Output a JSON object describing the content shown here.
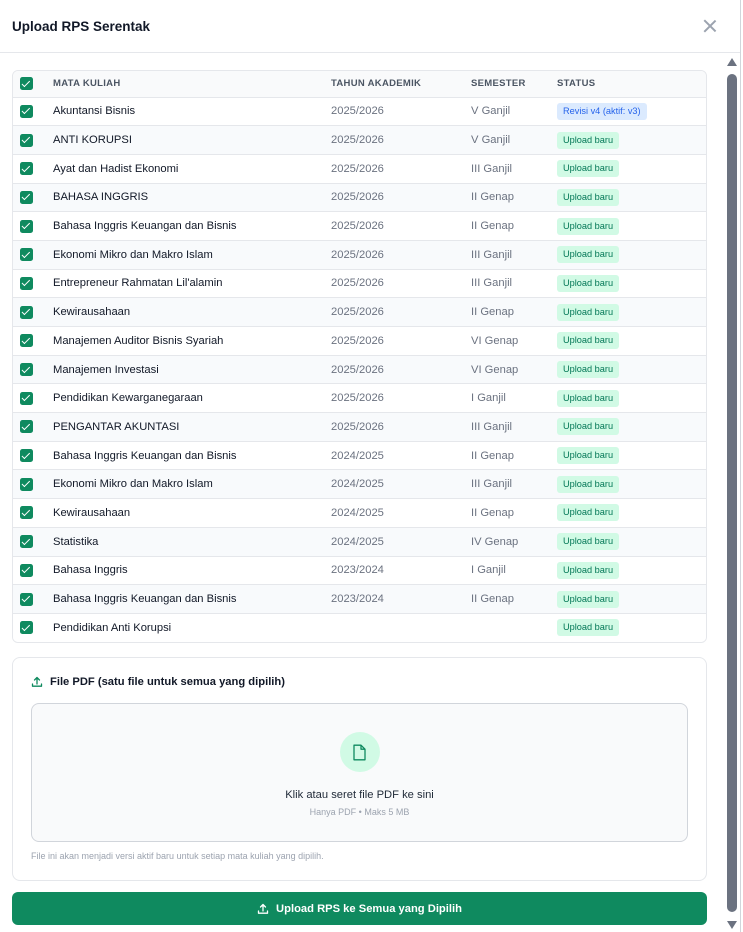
{
  "modal": {
    "title": "Upload RPS Serentak"
  },
  "table": {
    "headers": {
      "mata_kuliah": "MATA KULIAH",
      "tahun_akademik": "TAHUN AKADEMIK",
      "semester": "SEMESTER",
      "status": "STATUS"
    },
    "rows": [
      {
        "mata_kuliah": "Akuntansi Bisnis",
        "tahun": "2025/2026",
        "semester": "V Ganjil",
        "status": "Revisi v4 (aktif: v3)",
        "status_type": "revision"
      },
      {
        "mata_kuliah": "ANTI KORUPSI",
        "tahun": "2025/2026",
        "semester": "V Ganjil",
        "status": "Upload baru",
        "status_type": "new"
      },
      {
        "mata_kuliah": "Ayat dan Hadist Ekonomi",
        "tahun": "2025/2026",
        "semester": "III Ganjil",
        "status": "Upload baru",
        "status_type": "new"
      },
      {
        "mata_kuliah": "BAHASA INGGRIS",
        "tahun": "2025/2026",
        "semester": "II Genap",
        "status": "Upload baru",
        "status_type": "new"
      },
      {
        "mata_kuliah": "Bahasa Inggris Keuangan dan Bisnis",
        "tahun": "2025/2026",
        "semester": "II Genap",
        "status": "Upload baru",
        "status_type": "new"
      },
      {
        "mata_kuliah": "Ekonomi Mikro dan Makro Islam",
        "tahun": "2025/2026",
        "semester": "III Ganjil",
        "status": "Upload baru",
        "status_type": "new"
      },
      {
        "mata_kuliah": "Entrepreneur Rahmatan Lil'alamin",
        "tahun": "2025/2026",
        "semester": "III Ganjil",
        "status": "Upload baru",
        "status_type": "new"
      },
      {
        "mata_kuliah": "Kewirausahaan",
        "tahun": "2025/2026",
        "semester": "II Genap",
        "status": "Upload baru",
        "status_type": "new"
      },
      {
        "mata_kuliah": "Manajemen Auditor Bisnis Syariah",
        "tahun": "2025/2026",
        "semester": "VI Genap",
        "status": "Upload baru",
        "status_type": "new"
      },
      {
        "mata_kuliah": "Manajemen Investasi",
        "tahun": "2025/2026",
        "semester": "VI Genap",
        "status": "Upload baru",
        "status_type": "new"
      },
      {
        "mata_kuliah": "Pendidikan Kewarganegaraan",
        "tahun": "2025/2026",
        "semester": "I Ganjil",
        "status": "Upload baru",
        "status_type": "new"
      },
      {
        "mata_kuliah": "PENGANTAR AKUNTASI",
        "tahun": "2025/2026",
        "semester": "III Ganjil",
        "status": "Upload baru",
        "status_type": "new"
      },
      {
        "mata_kuliah": "Bahasa Inggris Keuangan dan Bisnis",
        "tahun": "2024/2025",
        "semester": "II Genap",
        "status": "Upload baru",
        "status_type": "new"
      },
      {
        "mata_kuliah": "Ekonomi Mikro dan Makro Islam",
        "tahun": "2024/2025",
        "semester": "III Ganjil",
        "status": "Upload baru",
        "status_type": "new"
      },
      {
        "mata_kuliah": "Kewirausahaan",
        "tahun": "2024/2025",
        "semester": "II Genap",
        "status": "Upload baru",
        "status_type": "new"
      },
      {
        "mata_kuliah": "Statistika",
        "tahun": "2024/2025",
        "semester": "IV Genap",
        "status": "Upload baru",
        "status_type": "new"
      },
      {
        "mata_kuliah": "Bahasa Inggris",
        "tahun": "2023/2024",
        "semester": "I Ganjil",
        "status": "Upload baru",
        "status_type": "new"
      },
      {
        "mata_kuliah": "Bahasa Inggris Keuangan dan Bisnis",
        "tahun": "2023/2024",
        "semester": "II Genap",
        "status": "Upload baru",
        "status_type": "new"
      },
      {
        "mata_kuliah": "Pendidikan Anti Korupsi",
        "tahun": "",
        "semester": "",
        "status": "Upload baru",
        "status_type": "new"
      }
    ]
  },
  "upload": {
    "label": "File PDF (satu file untuk semua yang dipilih)",
    "dropzone_text": "Klik atau seret file PDF ke sini",
    "dropzone_subtext": "Hanya PDF • Maks 5 MB",
    "hint": "File ini akan menjadi versi aktif baru untuk setiap mata kuliah yang dipilih."
  },
  "submit_label": "Upload RPS ke Semua yang Dipilih",
  "colors": {
    "primary": "#0f8a5f",
    "badge_green_bg": "#d1fae5",
    "badge_green_text": "#047857",
    "badge_blue_bg": "#dbeafe",
    "badge_blue_text": "#2563eb"
  }
}
